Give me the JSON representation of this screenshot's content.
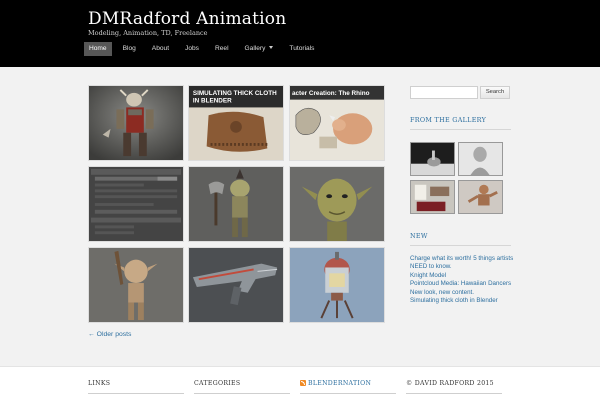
{
  "header": {
    "title": "DMRadford Animation",
    "description": "Modeling, Animation, TD, Freelance"
  },
  "nav": {
    "items": [
      {
        "label": "Home",
        "active": true
      },
      {
        "label": "Blog"
      },
      {
        "label": "About"
      },
      {
        "label": "Jobs"
      },
      {
        "label": "Reel"
      },
      {
        "label": "Gallery",
        "dropdown": true
      },
      {
        "label": "Tutorials"
      }
    ]
  },
  "posts": {
    "thumbs": [
      {
        "subject": "armored-character",
        "caption": ""
      },
      {
        "subject": "cloth-tutorial",
        "caption": "SIMULATING THICK CLOTH\nIN BLENDER"
      },
      {
        "subject": "rhino-character",
        "caption": "acter Creation: The Rhino"
      },
      {
        "subject": "settings-panel",
        "caption": ""
      },
      {
        "subject": "troll-with-axe",
        "caption": ""
      },
      {
        "subject": "goblin-face",
        "caption": ""
      },
      {
        "subject": "goblin-with-club",
        "caption": ""
      },
      {
        "subject": "rifle-model",
        "caption": ""
      },
      {
        "subject": "robot-lamp",
        "caption": ""
      }
    ],
    "older_label": "← Older posts"
  },
  "sidebar": {
    "search": {
      "placeholder": "",
      "value": "",
      "button_label": "Search"
    },
    "gallery_title": "FROM THE GALLERY",
    "gallery_thumbs": [
      "render-scene",
      "bust-sculpt",
      "room-interior",
      "character-pose"
    ],
    "news_title": "NEW",
    "news_items": [
      "Charge what its worth! 5 things artists NEED to know.",
      "Knight Model",
      "Pointcloud Media: Hawaiian Dancers",
      "New look, new content.",
      "Simulating thick cloth in Blender"
    ]
  },
  "footer": {
    "links_title": "LINKS",
    "categories_title": "CATEGORIES",
    "blendernation_title": "BLENDERNATION",
    "copyright": "© DAVID RADFORD 2015"
  },
  "colors": {
    "header_bg": "#000000",
    "link": "#2d6f9f",
    "page_bg": "#f2f2f2"
  }
}
